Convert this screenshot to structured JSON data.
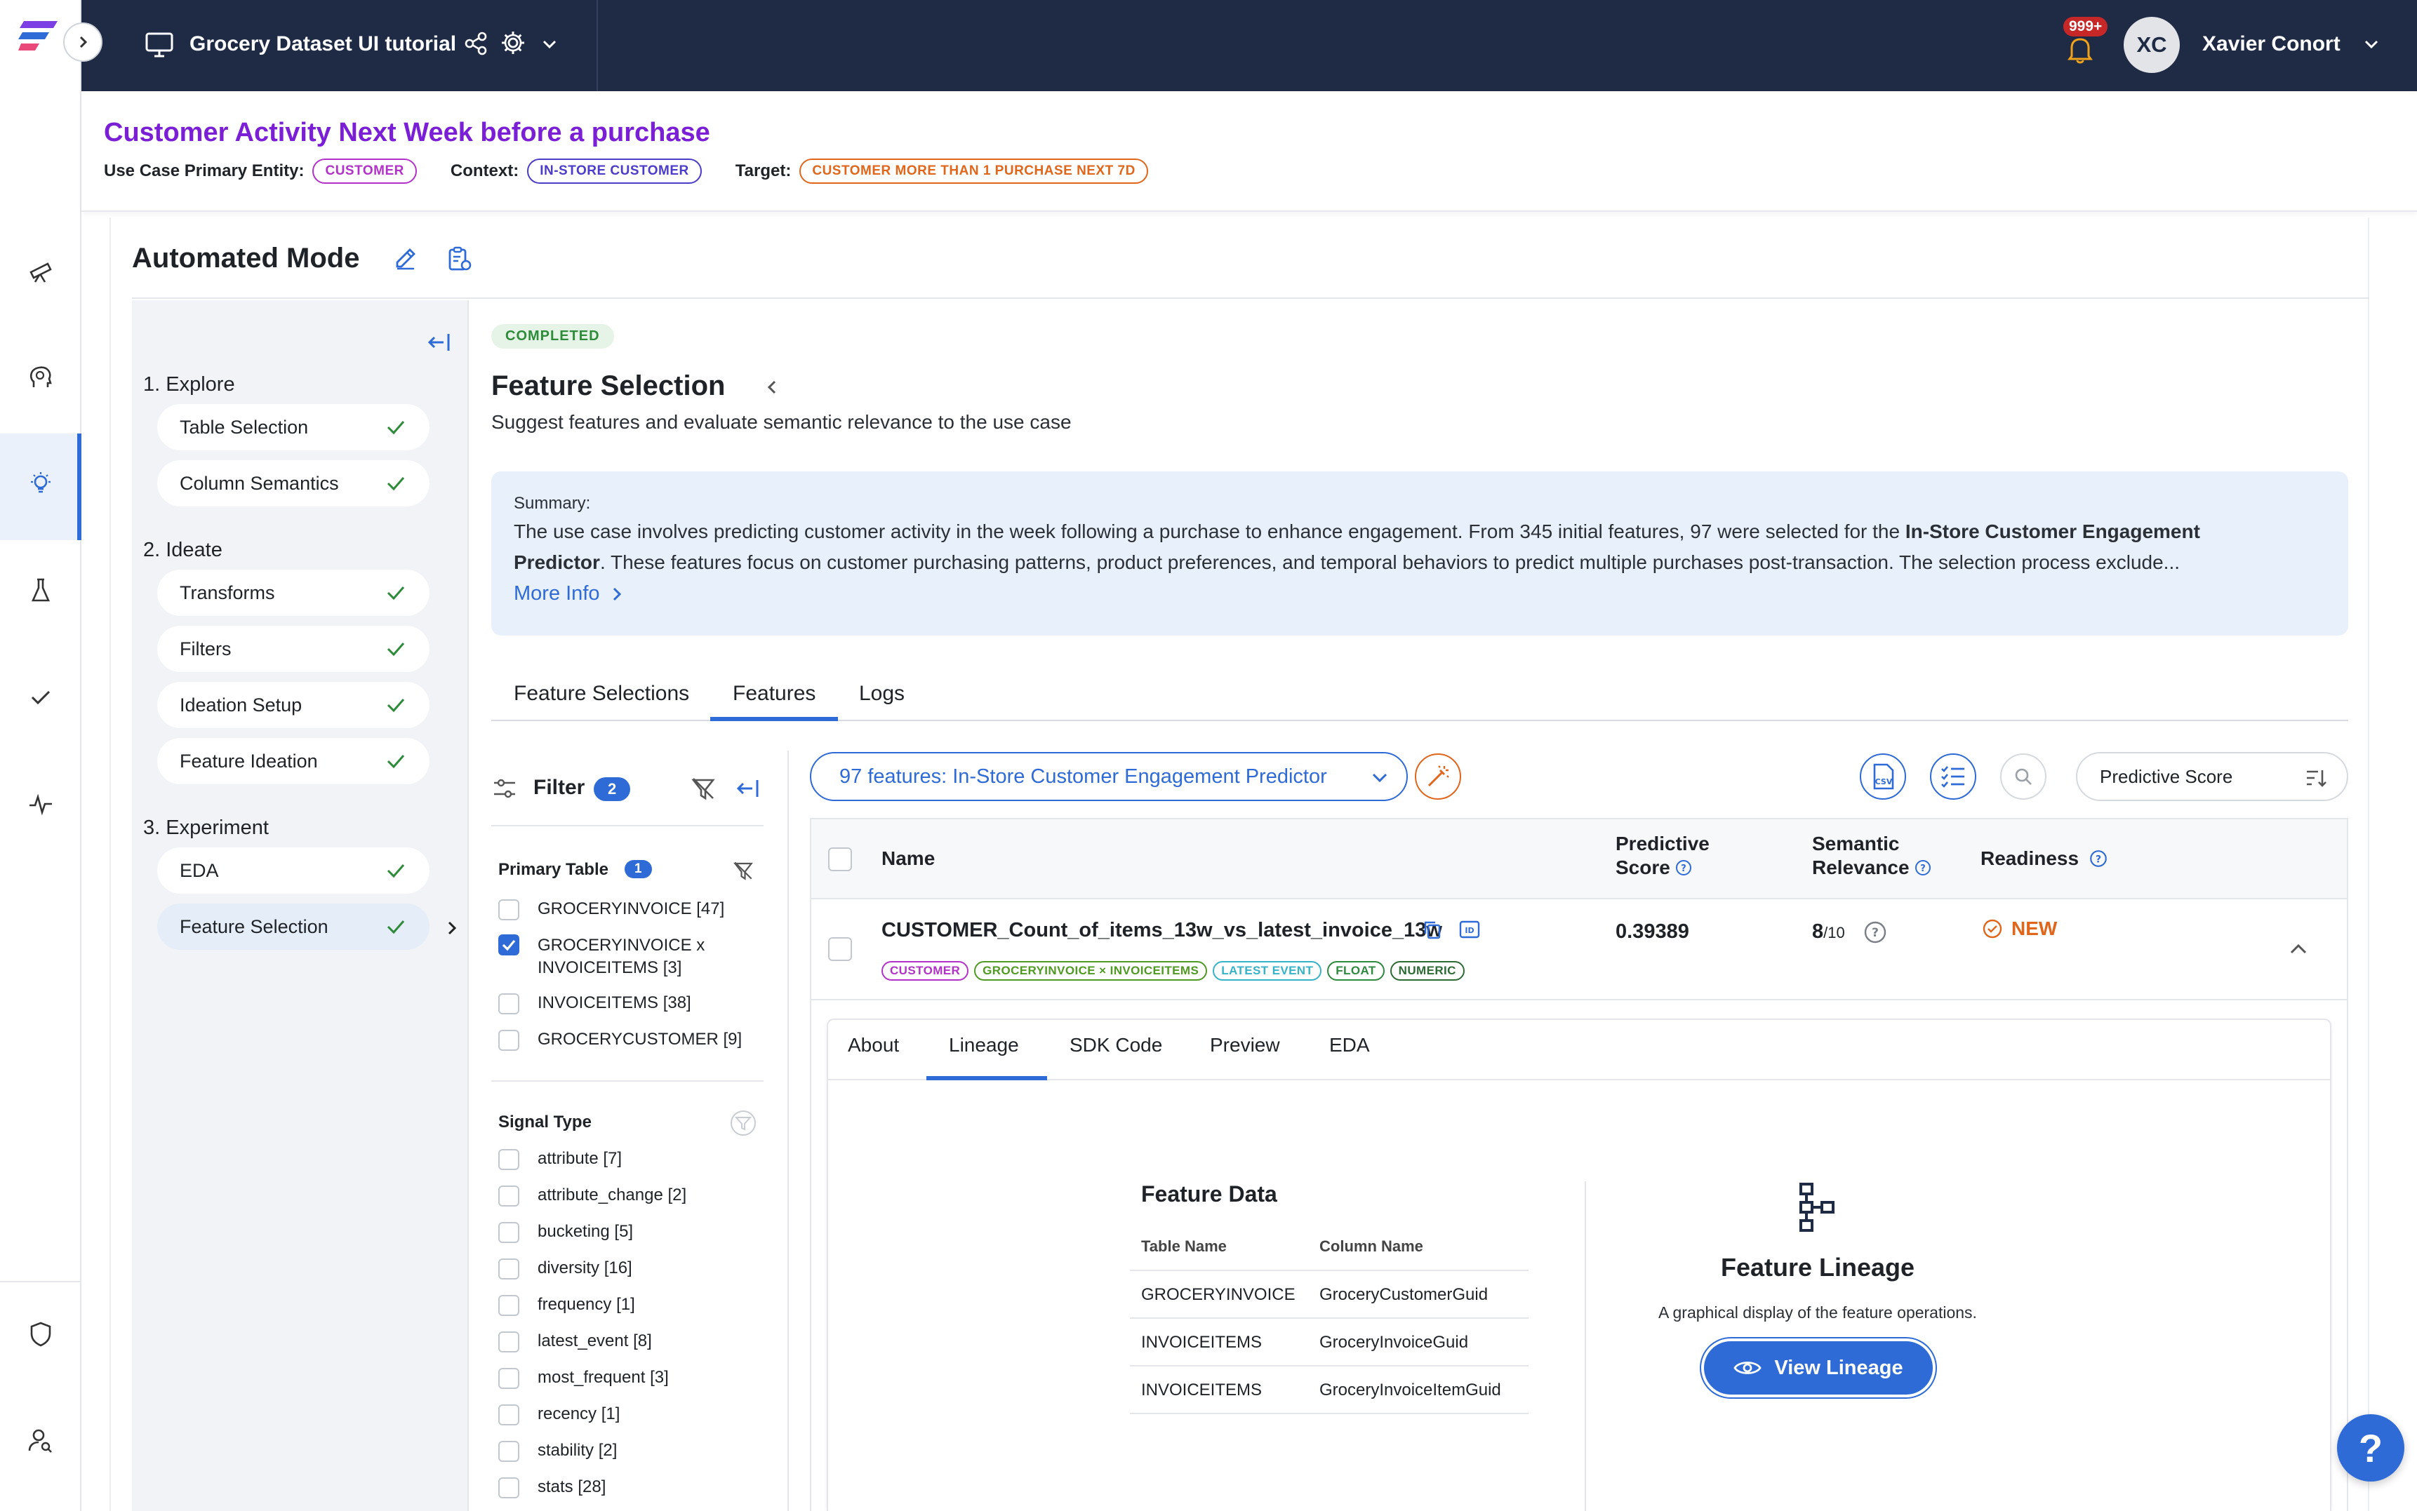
{
  "topbar": {
    "project_title": "Grocery Dataset UI tutorial",
    "notifications_count": "999+",
    "user_initials": "XC",
    "user_name": "Xavier Conort"
  },
  "header": {
    "title": "Customer Activity Next Week before a purchase",
    "primary_entity_label": "Use Case Primary Entity:",
    "primary_entity_value": "CUSTOMER",
    "context_label": "Context:",
    "context_value": "IN-STORE CUSTOMER",
    "target_label": "Target:",
    "target_value": "CUSTOMER MORE THAN 1 PURCHASE NEXT 7D"
  },
  "mode": {
    "title": "Automated Mode"
  },
  "steps": {
    "explore_heading": "1. Explore",
    "ideate_heading": "2. Ideate",
    "experiment_heading": "3. Experiment",
    "items": [
      "Table Selection",
      "Column Semantics",
      "Transforms",
      "Filters",
      "Ideation Setup",
      "Feature Ideation",
      "EDA",
      "Feature Selection"
    ]
  },
  "feature_selection": {
    "status_badge": "COMPLETED",
    "title": "Feature Selection",
    "subtitle": "Suggest features and evaluate semantic relevance to the use case",
    "summary_label": "Summary:",
    "summary_text_1": "The use case involves predicting customer activity in the week following a purchase to enhance engagement. From 345 initial features, 97 were selected for the ",
    "summary_bold_1": "In-Store Customer Engagement",
    "summary_bold_2": "Predictor",
    "summary_text_2": ". These features focus on customer purchasing patterns, product preferences, and temporal behaviors to predict multiple purchases post-transaction. The selection process exclude...",
    "more_info": "More Info"
  },
  "tabs": [
    "Feature Selections",
    "Features",
    "Logs"
  ],
  "filter": {
    "label": "Filter",
    "count": "2",
    "primary_table_title": "Primary Table",
    "primary_table_count": "1",
    "primary_tables": [
      {
        "label": "GROCERYINVOICE [47]",
        "checked": false
      },
      {
        "label": "GROCERYINVOICE x",
        "label2": "INVOICEITEMS [3]",
        "checked": true
      },
      {
        "label": "INVOICEITEMS [38]",
        "checked": false
      },
      {
        "label": "GROCERYCUSTOMER [9]",
        "checked": false
      }
    ],
    "signal_type_title": "Signal Type",
    "signal_types": [
      "attribute [7]",
      "attribute_change [2]",
      "bucketing [5]",
      "diversity [16]",
      "frequency [1]",
      "latest_event [8]",
      "most_frequent [3]",
      "recency [1]",
      "stability [2]",
      "stats [28]"
    ]
  },
  "features_panel": {
    "selection_dropdown": "97 features: In-Store Customer Engagement Predictor",
    "sort_select": "Predictive Score",
    "columns": {
      "name": "Name",
      "predictive_score_1": "Predictive",
      "predictive_score_2": "Score",
      "semantic_relevance_1": "Semantic",
      "semantic_relevance_2": "Relevance",
      "readiness": "Readiness"
    },
    "row": {
      "name": "CUSTOMER_Count_of_items_13w_vs_latest_invoice_13w",
      "predictive_score": "0.39389",
      "semantic_relevance": "8",
      "semantic_relevance_of": "/10",
      "readiness": "NEW",
      "tags": [
        {
          "label": "CUSTOMER",
          "color": "#b232c9"
        },
        {
          "label": "GROCERYINVOICE × INVOICEITEMS",
          "color": "#4f9a22"
        },
        {
          "label": "LATEST EVENT",
          "color": "#37b3c9"
        },
        {
          "label": "FLOAT",
          "color": "#2d8a3e"
        },
        {
          "label": "NUMERIC",
          "color": "#2d6b35"
        }
      ]
    },
    "detail_tabs": [
      "About",
      "Lineage",
      "SDK Code",
      "Preview",
      "EDA"
    ],
    "feature_data": {
      "title": "Feature Data",
      "col_table": "Table Name",
      "col_column": "Column Name",
      "rows": [
        {
          "table": "GROCERYINVOICE",
          "column": "GroceryCustomerGuid"
        },
        {
          "table": "INVOICEITEMS",
          "column": "GroceryInvoiceGuid"
        },
        {
          "table": "INVOICEITEMS",
          "column": "GroceryInvoiceItemGuid"
        }
      ]
    },
    "lineage": {
      "title": "Feature Lineage",
      "description": "A graphical display of the feature operations.",
      "button": "View Lineage"
    }
  },
  "help_button": "?",
  "colors": {
    "brand_blue": "#2f6bd6",
    "title_purple": "#7a1fd6",
    "topbar_navy": "#1f2a44",
    "success_green": "#2e8b3a",
    "warning_orange": "#e0661b"
  }
}
